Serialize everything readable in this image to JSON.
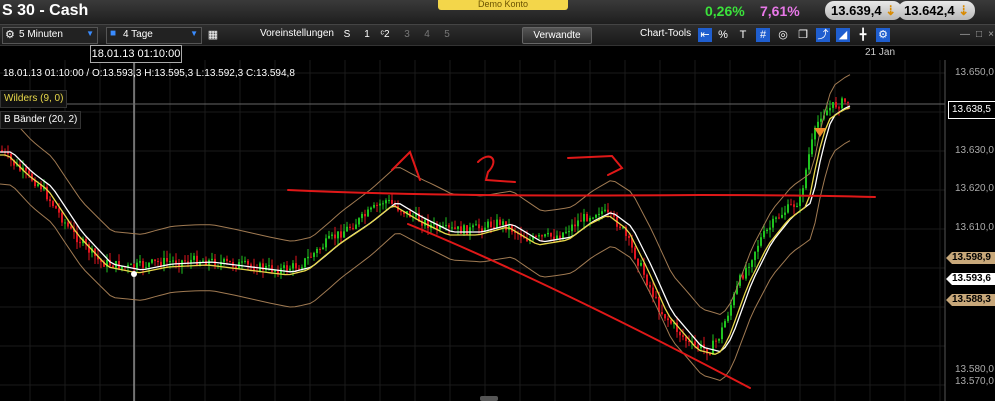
{
  "header": {
    "title": "S 30 - Cash",
    "demo_label": "Demo Konto",
    "change_pct": "0,26%",
    "change_pct2": "7,61%",
    "bid": "13.639,4",
    "ask": "13.642,4"
  },
  "toolbar": {
    "interval": "5 Minuten",
    "range": "4 Tage",
    "presets_label": "Voreinstellungen",
    "s_label": "S",
    "preset_1": "1",
    "preset_2": "2",
    "preset_3": "3",
    "preset_4": "4",
    "preset_5": "5",
    "related_label": "Verwandte",
    "chart_tools_label": "Chart-Tools"
  },
  "chart": {
    "crosshair_time": "18.01.13 01:10:00",
    "date_axis_label": "21 Jan",
    "ohlc_text": "18.01.13 01:10:00 / O:13.593,3   H:13.595,3   L:13.592,3   C:13.594,8",
    "indicator_wilders": "Wilders (9, 0)",
    "indicator_bb": "B Bänder (20, 2)",
    "y_labels": [
      "13.650,0",
      "13.640,0",
      "13.630,0",
      "13.620,0",
      "13.610,0",
      "13.600,0",
      "13.590,0",
      "13.580,0",
      "13.570,0"
    ],
    "current_price": "13.638,5",
    "tag_upper": "13.598,9",
    "tag_mid": "13.593,6",
    "tag_lower": "13.588,3",
    "colors": {
      "up": "#1fc41f",
      "down": "#e0141e",
      "band": "#a07a52",
      "wilders": "#e8d84a",
      "ma": "#ffffff",
      "annot": "#e01818"
    }
  }
}
